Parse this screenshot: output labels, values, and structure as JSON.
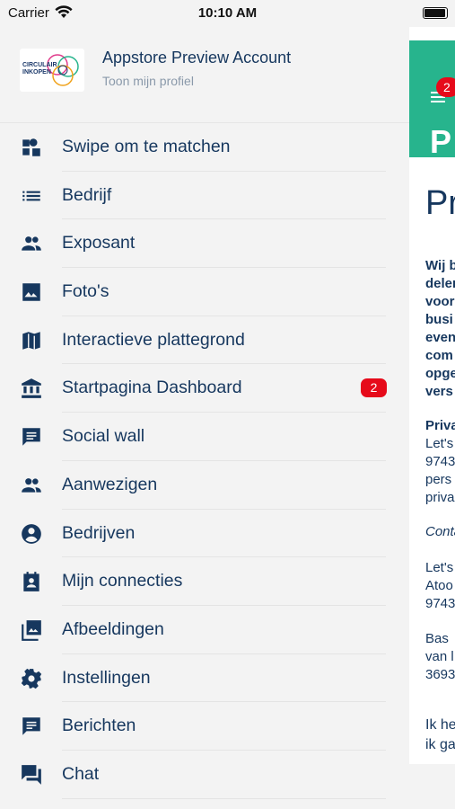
{
  "status_bar": {
    "carrier": "Carrier",
    "time": "10:10 AM",
    "battery_level": 1.0
  },
  "profile": {
    "logo_text": "CIRCULAIR INKOPEN",
    "name": "Appstore Preview Account",
    "subtitle": "Toon mijn profiel"
  },
  "menu": {
    "items": [
      {
        "label": "Swipe om te matchen",
        "icon": "swipe-match-icon"
      },
      {
        "label": "Bedrijf",
        "icon": "list-icon"
      },
      {
        "label": "Exposant",
        "icon": "people-icon"
      },
      {
        "label": "Foto's",
        "icon": "photo-icon"
      },
      {
        "label": "Interactieve plattegrond",
        "icon": "map-icon"
      },
      {
        "label": "Startpagina Dashboard",
        "icon": "bank-icon",
        "badge": "2"
      },
      {
        "label": "Social wall",
        "icon": "chat-bubble-icon"
      },
      {
        "label": "Aanwezigen",
        "icon": "people-icon"
      },
      {
        "label": "Bedrijven",
        "icon": "account-circle-icon"
      },
      {
        "label": "Mijn connecties",
        "icon": "contact-calendar-icon"
      },
      {
        "label": "Afbeeldingen",
        "icon": "photo-library-icon"
      },
      {
        "label": "Instellingen",
        "icon": "gear-icon"
      },
      {
        "label": "Berichten",
        "icon": "message-icon"
      },
      {
        "label": "Chat",
        "icon": "forum-icon"
      }
    ]
  },
  "panel": {
    "header_badge": "2",
    "header_title": "P",
    "page_title": "Pr",
    "lines_bold": [
      "Wij b",
      "delen",
      "voor",
      "busi",
      "even",
      "com",
      "opge",
      "vers"
    ],
    "priv_title": "Priva",
    "priv_lines": [
      "Let's",
      "9743",
      "pers",
      "priva"
    ],
    "contact_label": "Conta",
    "contact_lines": [
      "Let's",
      "Atoo",
      "9743"
    ],
    "person_lines": [
      "Bas",
      "van l",
      "3693"
    ],
    "footer_lines": [
      "Ik he",
      "ik ga"
    ]
  },
  "colors": {
    "primary": "#16375e",
    "accent_green": "#27b48d",
    "badge_red": "#e60a1a",
    "background": "#f3f3f3"
  }
}
